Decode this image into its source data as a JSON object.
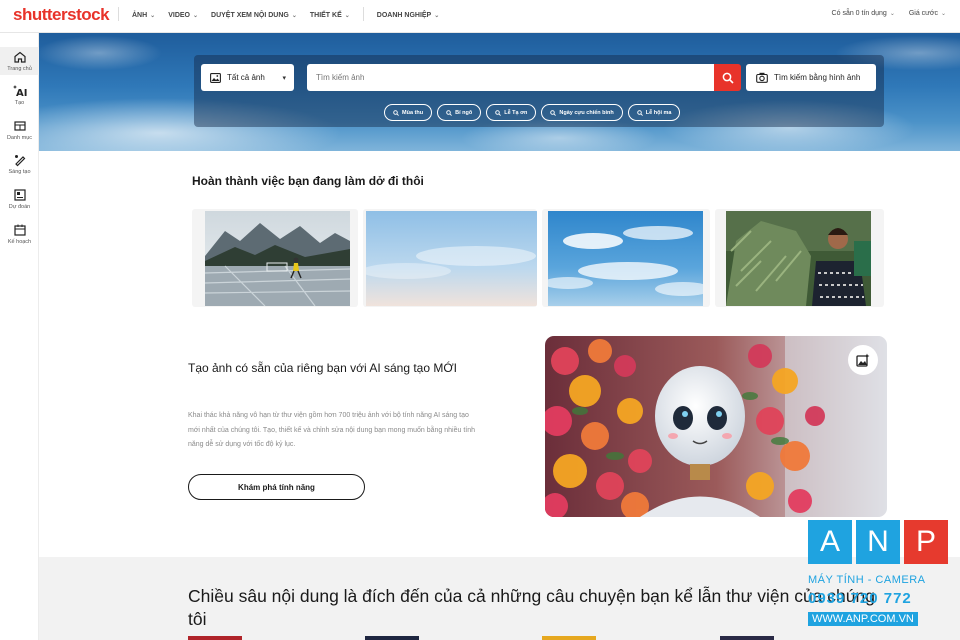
{
  "brand": {
    "logo": "shutterstock",
    "color": "#e8332a"
  },
  "topnav": {
    "items": [
      {
        "label": "ẢNH"
      },
      {
        "label": "VIDEO"
      },
      {
        "label": "DUYỆT XEM NỘI DUNG"
      },
      {
        "label": "THIẾT KẾ"
      },
      {
        "label": "DOANH NGHIỆP"
      }
    ],
    "right": {
      "available": "Có sẵn 0 tín dụng",
      "pricing": "Giá cước"
    }
  },
  "sidebar": {
    "items": [
      {
        "label": "Trang chủ",
        "icon": "home-icon"
      },
      {
        "label": "Tạo",
        "icon": "ai-sparkle-icon"
      },
      {
        "label": "Danh mục",
        "icon": "catalog-icon"
      },
      {
        "label": "Sáng tạo",
        "icon": "create-icon"
      },
      {
        "label": "Dự đoán",
        "icon": "predict-icon"
      },
      {
        "label": "Kế hoạch",
        "icon": "plan-icon"
      }
    ]
  },
  "hero": {
    "type_select": "Tất cả ảnh",
    "search_placeholder": "Tìm kiếm ảnh",
    "image_search": "Tìm kiếm bằng hình ảnh",
    "chips": [
      "Mùa thu",
      "Bí ngô",
      "Lễ Tạ ơn",
      "Ngày cựu chiến binh",
      "Lễ hội ma"
    ]
  },
  "continue": {
    "title": "Hoàn thành việc bạn đang làm dở đi thôi"
  },
  "ai_section": {
    "title": "Tạo ảnh có sẵn của riêng bạn với AI sáng tạo MỚI",
    "description": "Khai thác khả năng vô hạn từ thư viện gồm hơn 700 triệu ảnh với bộ tính năng AI sáng tạo mới nhất của chúng tôi. Tạo, thiết kế và chỉnh sửa nội dung bạn mong muốn bằng nhiều tính năng dễ sử dụng với tốc độ kỷ lục.",
    "button": "Khám phá tính năng"
  },
  "bottom": {
    "title": "Chiều sâu nội dung là đích đến của cả những câu chuyện bạn kể lẫn thư viện của chúng tôi"
  },
  "watermark": {
    "letters": [
      "A",
      "N",
      "P"
    ],
    "line1": "MÁY TÍNH - CAMERA",
    "line2": "0939 720 772",
    "line3": "WWW.ANP.COM.VN"
  }
}
